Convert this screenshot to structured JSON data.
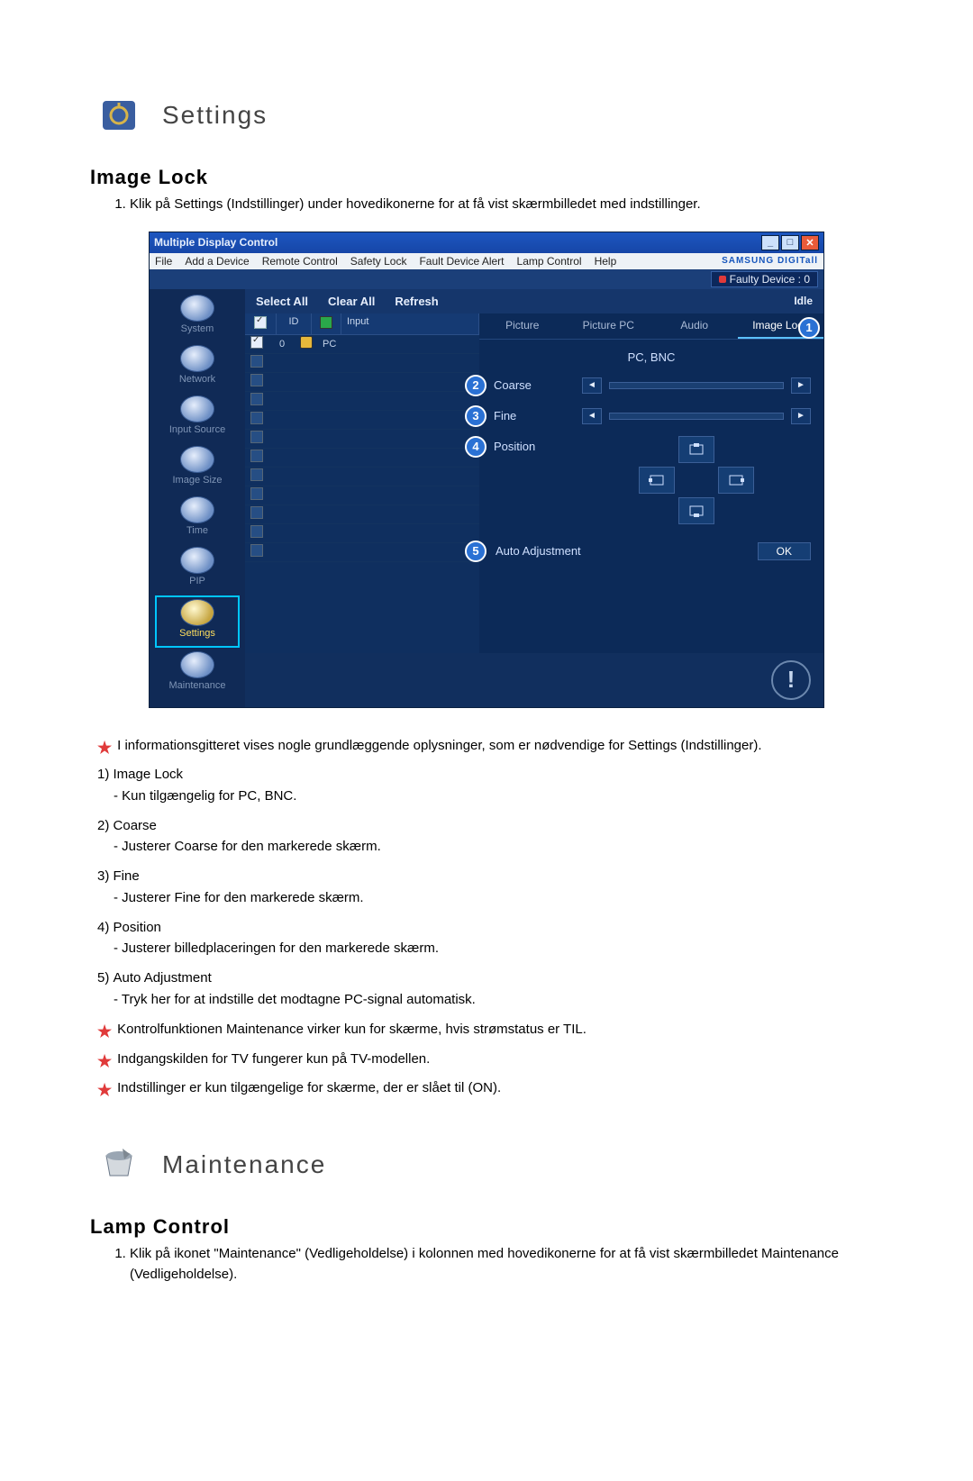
{
  "settings": {
    "title": "Settings",
    "sub_heading": "Image Lock",
    "step1": "Klik på Settings (Indstillinger) under hovedikonerne for at få vist skærmbilledet med indstillinger."
  },
  "app": {
    "title": "Multiple Display Control",
    "menu": [
      "File",
      "Add a Device",
      "Remote Control",
      "Safety Lock",
      "Fault Device Alert",
      "Lamp Control",
      "Help"
    ],
    "brand": "SAMSUNG DIGITall",
    "faulty": "Faulty Device : 0",
    "toolbar": {
      "select_all": "Select All",
      "clear_all": "Clear All",
      "refresh": "Refresh",
      "idle": "Idle"
    },
    "sidebar": [
      "System",
      "Network",
      "Input Source",
      "Image Size",
      "Time",
      "PIP",
      "Settings",
      "Maintenance"
    ],
    "grid": {
      "headers": {
        "id": "ID",
        "input": "Input"
      },
      "row": {
        "id": "0",
        "input": "PC"
      }
    },
    "tabs": [
      "Picture",
      "Picture PC",
      "Audio",
      "Image Lock"
    ],
    "panel": {
      "mode": "PC, BNC",
      "coarse": "Coarse",
      "fine": "Fine",
      "position": "Position",
      "auto": "Auto Adjustment",
      "ok": "OK"
    },
    "callouts": {
      "n1": "1",
      "n2": "2",
      "n3": "3",
      "n4": "4",
      "n5": "5"
    }
  },
  "info": {
    "star1": "I informationsgitteret vises nogle grundlæggende oplysninger, som er nødvendige for Settings (Indstillinger).",
    "list": [
      {
        "n": "1)",
        "t": "Image Lock",
        "s": "- Kun tilgængelig for PC, BNC."
      },
      {
        "n": "2)",
        "t": "Coarse",
        "s": "- Justerer Coarse for den markerede skærm."
      },
      {
        "n": "3)",
        "t": "Fine",
        "s": "- Justerer Fine for den markerede skærm."
      },
      {
        "n": "4)",
        "t": "Position",
        "s": "- Justerer billedplaceringen for den markerede skærm."
      },
      {
        "n": "5)",
        "t": "Auto Adjustment",
        "s": "- Tryk her for at indstille det modtagne PC-signal automatisk."
      }
    ],
    "star2": "Kontrolfunktionen Maintenance virker kun for skærme, hvis strømstatus er TIL.",
    "star3": "Indgangskilden for TV fungerer kun på TV-modellen.",
    "star4": "Indstillinger er kun tilgængelige for skærme, der er slået til (ON)."
  },
  "maintenance": {
    "title": "Maintenance",
    "sub_heading": "Lamp Control",
    "step1": "Klik på ikonet \"Maintenance\" (Vedligeholdelse) i kolonnen med hovedikonerne for at få vist skærmbilledet Maintenance (Vedligeholdelse)."
  }
}
